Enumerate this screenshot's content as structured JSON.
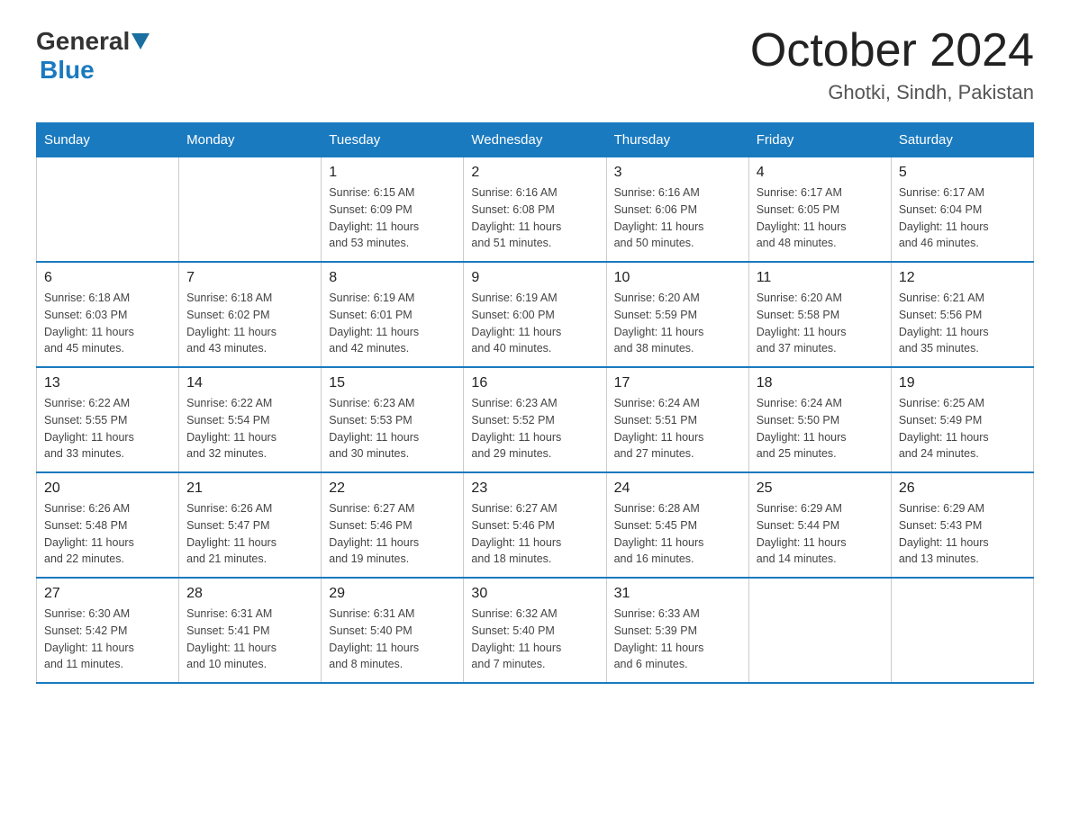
{
  "header": {
    "logo_general": "General",
    "logo_blue": "Blue",
    "month_title": "October 2024",
    "location": "Ghotki, Sindh, Pakistan"
  },
  "days_of_week": [
    "Sunday",
    "Monday",
    "Tuesday",
    "Wednesday",
    "Thursday",
    "Friday",
    "Saturday"
  ],
  "weeks": [
    [
      {
        "day": "",
        "detail": ""
      },
      {
        "day": "",
        "detail": ""
      },
      {
        "day": "1",
        "detail": "Sunrise: 6:15 AM\nSunset: 6:09 PM\nDaylight: 11 hours\nand 53 minutes."
      },
      {
        "day": "2",
        "detail": "Sunrise: 6:16 AM\nSunset: 6:08 PM\nDaylight: 11 hours\nand 51 minutes."
      },
      {
        "day": "3",
        "detail": "Sunrise: 6:16 AM\nSunset: 6:06 PM\nDaylight: 11 hours\nand 50 minutes."
      },
      {
        "day": "4",
        "detail": "Sunrise: 6:17 AM\nSunset: 6:05 PM\nDaylight: 11 hours\nand 48 minutes."
      },
      {
        "day": "5",
        "detail": "Sunrise: 6:17 AM\nSunset: 6:04 PM\nDaylight: 11 hours\nand 46 minutes."
      }
    ],
    [
      {
        "day": "6",
        "detail": "Sunrise: 6:18 AM\nSunset: 6:03 PM\nDaylight: 11 hours\nand 45 minutes."
      },
      {
        "day": "7",
        "detail": "Sunrise: 6:18 AM\nSunset: 6:02 PM\nDaylight: 11 hours\nand 43 minutes."
      },
      {
        "day": "8",
        "detail": "Sunrise: 6:19 AM\nSunset: 6:01 PM\nDaylight: 11 hours\nand 42 minutes."
      },
      {
        "day": "9",
        "detail": "Sunrise: 6:19 AM\nSunset: 6:00 PM\nDaylight: 11 hours\nand 40 minutes."
      },
      {
        "day": "10",
        "detail": "Sunrise: 6:20 AM\nSunset: 5:59 PM\nDaylight: 11 hours\nand 38 minutes."
      },
      {
        "day": "11",
        "detail": "Sunrise: 6:20 AM\nSunset: 5:58 PM\nDaylight: 11 hours\nand 37 minutes."
      },
      {
        "day": "12",
        "detail": "Sunrise: 6:21 AM\nSunset: 5:56 PM\nDaylight: 11 hours\nand 35 minutes."
      }
    ],
    [
      {
        "day": "13",
        "detail": "Sunrise: 6:22 AM\nSunset: 5:55 PM\nDaylight: 11 hours\nand 33 minutes."
      },
      {
        "day": "14",
        "detail": "Sunrise: 6:22 AM\nSunset: 5:54 PM\nDaylight: 11 hours\nand 32 minutes."
      },
      {
        "day": "15",
        "detail": "Sunrise: 6:23 AM\nSunset: 5:53 PM\nDaylight: 11 hours\nand 30 minutes."
      },
      {
        "day": "16",
        "detail": "Sunrise: 6:23 AM\nSunset: 5:52 PM\nDaylight: 11 hours\nand 29 minutes."
      },
      {
        "day": "17",
        "detail": "Sunrise: 6:24 AM\nSunset: 5:51 PM\nDaylight: 11 hours\nand 27 minutes."
      },
      {
        "day": "18",
        "detail": "Sunrise: 6:24 AM\nSunset: 5:50 PM\nDaylight: 11 hours\nand 25 minutes."
      },
      {
        "day": "19",
        "detail": "Sunrise: 6:25 AM\nSunset: 5:49 PM\nDaylight: 11 hours\nand 24 minutes."
      }
    ],
    [
      {
        "day": "20",
        "detail": "Sunrise: 6:26 AM\nSunset: 5:48 PM\nDaylight: 11 hours\nand 22 minutes."
      },
      {
        "day": "21",
        "detail": "Sunrise: 6:26 AM\nSunset: 5:47 PM\nDaylight: 11 hours\nand 21 minutes."
      },
      {
        "day": "22",
        "detail": "Sunrise: 6:27 AM\nSunset: 5:46 PM\nDaylight: 11 hours\nand 19 minutes."
      },
      {
        "day": "23",
        "detail": "Sunrise: 6:27 AM\nSunset: 5:46 PM\nDaylight: 11 hours\nand 18 minutes."
      },
      {
        "day": "24",
        "detail": "Sunrise: 6:28 AM\nSunset: 5:45 PM\nDaylight: 11 hours\nand 16 minutes."
      },
      {
        "day": "25",
        "detail": "Sunrise: 6:29 AM\nSunset: 5:44 PM\nDaylight: 11 hours\nand 14 minutes."
      },
      {
        "day": "26",
        "detail": "Sunrise: 6:29 AM\nSunset: 5:43 PM\nDaylight: 11 hours\nand 13 minutes."
      }
    ],
    [
      {
        "day": "27",
        "detail": "Sunrise: 6:30 AM\nSunset: 5:42 PM\nDaylight: 11 hours\nand 11 minutes."
      },
      {
        "day": "28",
        "detail": "Sunrise: 6:31 AM\nSunset: 5:41 PM\nDaylight: 11 hours\nand 10 minutes."
      },
      {
        "day": "29",
        "detail": "Sunrise: 6:31 AM\nSunset: 5:40 PM\nDaylight: 11 hours\nand 8 minutes."
      },
      {
        "day": "30",
        "detail": "Sunrise: 6:32 AM\nSunset: 5:40 PM\nDaylight: 11 hours\nand 7 minutes."
      },
      {
        "day": "31",
        "detail": "Sunrise: 6:33 AM\nSunset: 5:39 PM\nDaylight: 11 hours\nand 6 minutes."
      },
      {
        "day": "",
        "detail": ""
      },
      {
        "day": "",
        "detail": ""
      }
    ]
  ]
}
